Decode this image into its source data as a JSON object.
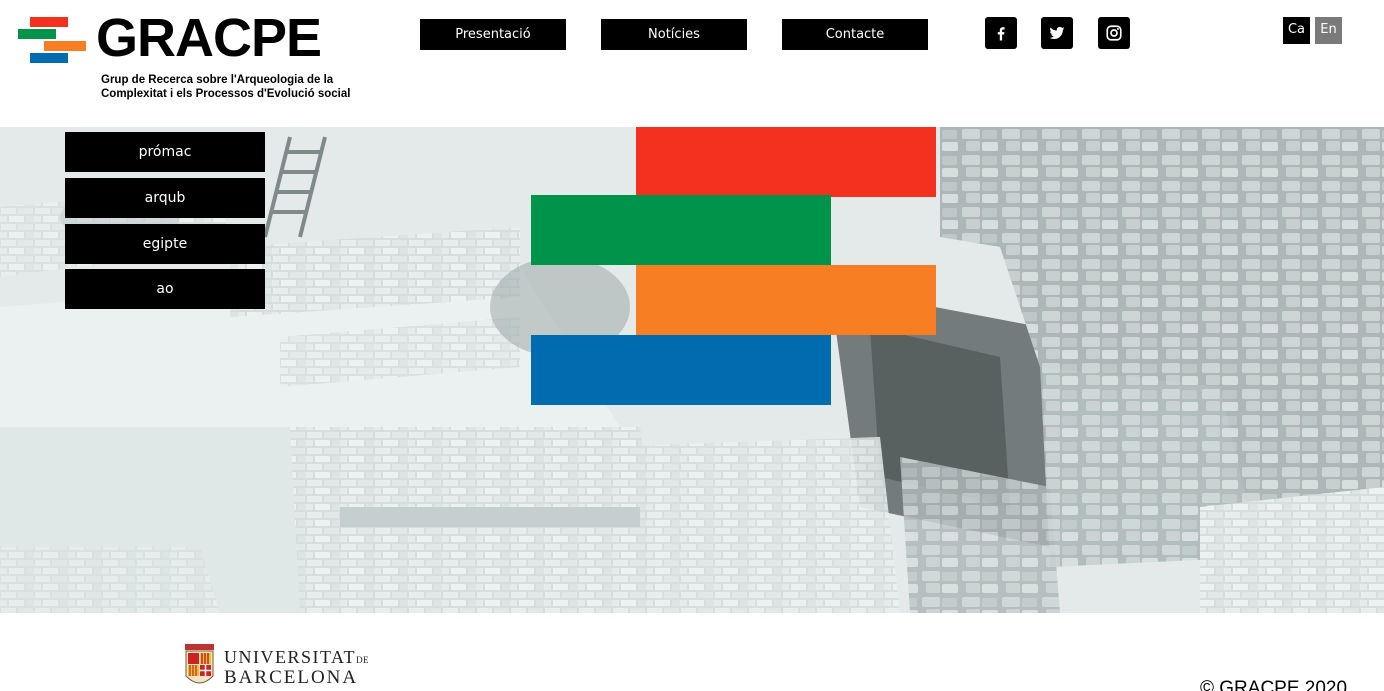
{
  "brand": {
    "name": "GRACPE",
    "subtitle_line1": "Grup de Recerca sobre l'Arqueologia de la",
    "subtitle_line2": "Complexitat i els Processos d'Evolució social",
    "colors": {
      "red": "#f4311e",
      "green": "#00944a",
      "orange": "#f77e23",
      "blue": "#006cb0"
    }
  },
  "nav": {
    "items": [
      {
        "label": "Presentació"
      },
      {
        "label": "Notícies"
      },
      {
        "label": "Contacte"
      }
    ]
  },
  "social": {
    "items": [
      {
        "icon": "facebook-icon"
      },
      {
        "icon": "twitter-icon"
      },
      {
        "icon": "instagram-icon"
      }
    ]
  },
  "languages": {
    "items": [
      {
        "label": "Ca",
        "active": true
      },
      {
        "label": "En",
        "active": false
      }
    ]
  },
  "projects": {
    "items": [
      {
        "label": "prómac"
      },
      {
        "label": "arqub"
      },
      {
        "label": "egipte"
      },
      {
        "label": "ao"
      }
    ]
  },
  "footer": {
    "university_line1": "UNIVERSITAT",
    "university_de": "DE",
    "university_line2": "BARCELONA",
    "copyright": "© GRACPE 2020"
  }
}
